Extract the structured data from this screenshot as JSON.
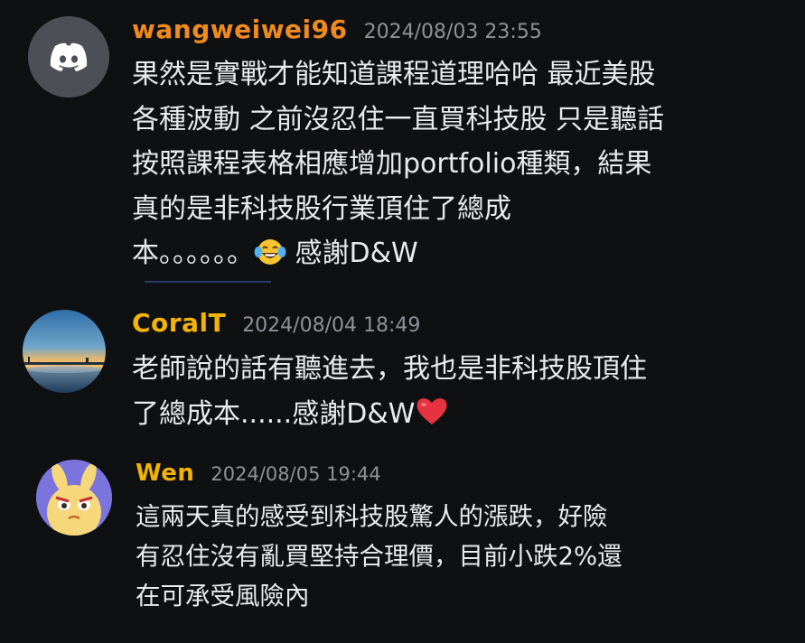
{
  "messages": [
    {
      "username": "wangweiwei96",
      "timestamp": "2024/08/03 23:55",
      "lines": [
        "果然是實戰才能知道課程道理哈哈 最近美股",
        "各種波動 之前沒忍住一直買科技股 只是聽話",
        "按照課程表格相應增加portfolio種類，結果",
        "真的是非科技股行業頂住了總成"
      ],
      "last_line_before_emoji": "本。。。。。。",
      "last_line_after_emoji": "感謝D&W",
      "avatar_icon": "discord-logo-icon",
      "emoji_icon": "laughing-tears-emoji-icon"
    },
    {
      "username": "CoralT",
      "timestamp": "2024/08/04 18:49",
      "lines": [
        "老師說的話有聽進去，我也是非科技股頂住"
      ],
      "last_line_before_emoji": "了總成本......感謝D&W",
      "avatar_icon": "sunset-landscape-avatar",
      "emoji_icon": "red-heart-emoji-icon"
    },
    {
      "username": "Wen",
      "timestamp": "2024/08/05 19:44",
      "lines": [
        "這兩天真的感受到科技股驚人的漲跌，好險",
        "有忍住沒有亂買堅持合理價，目前小跌2%還",
        "在可承受風險內"
      ],
      "avatar_icon": "yellow-rabbit-character-avatar"
    }
  ],
  "colors": {
    "background": "#0f1012",
    "username_1": "#f08a1c",
    "username_2": "#f2b400",
    "username_3": "#f2b400",
    "timestamp": "#8e9297",
    "text": "#e9eaec"
  }
}
